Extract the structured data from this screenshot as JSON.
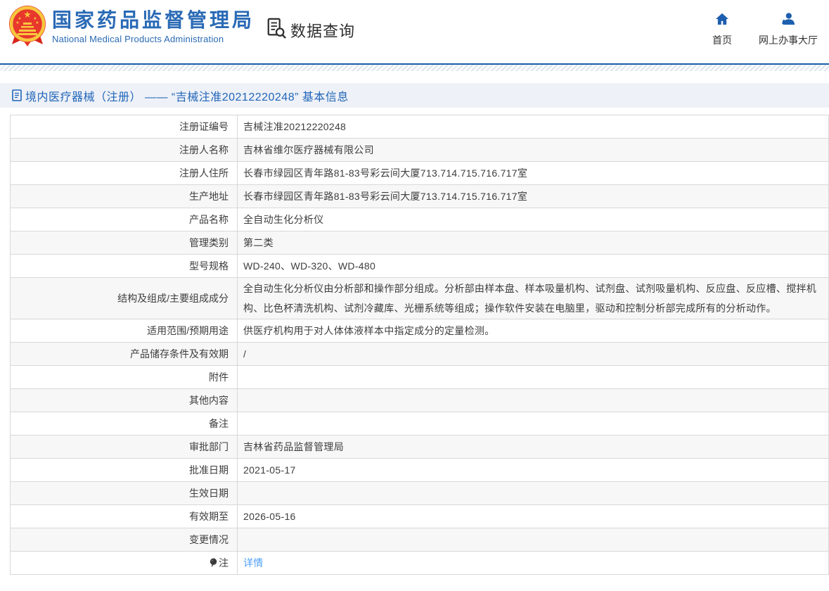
{
  "brand": {
    "name_zh": "国家药品监督管理局",
    "name_en": "National Medical Products Administration"
  },
  "top_nav": {
    "data_query_label": "数据查询",
    "home_label": "首页",
    "service_hall_label": "网上办事大厅"
  },
  "page_title": {
    "text": "境内医疗器械（注册） —— “吉械注准20212220248” 基本信息"
  },
  "colors": {
    "brand_blue": "#2a6ab5",
    "separator_blue": "#1a5fa8",
    "title_bar_bg": "#eef1f7",
    "title_text_blue": "#2065b8",
    "table_border": "#d8d8d8",
    "row_alt_bg": "#f7f7f7",
    "link_blue": "#4d9df5",
    "emblem_red": "#e8372c",
    "emblem_gold": "#f7c73e"
  },
  "table": {
    "rows": [
      {
        "label": "注册证编号",
        "value": "吉械注准20212220248"
      },
      {
        "label": "注册人名称",
        "value": "吉林省维尔医疗器械有限公司"
      },
      {
        "label": "注册人住所",
        "value": "长春市绿园区青年路81-83号彩云间大厦713.714.715.716.717室"
      },
      {
        "label": "生产地址",
        "value": "长春市绿园区青年路81-83号彩云间大厦713.714.715.716.717室"
      },
      {
        "label": "产品名称",
        "value": "全自动生化分析仪"
      },
      {
        "label": "管理类别",
        "value": "第二类"
      },
      {
        "label": "型号规格",
        "value": "WD-240、WD-320、WD-480"
      },
      {
        "label": "结构及组成/主要组成成分",
        "value": "全自动生化分析仪由分析部和操作部分组成。分析部由样本盘、样本吸量机构、试剂盘、试剂吸量机构、反应盘、反应槽、搅拌机构、比色杯清洗机构、试剂冷藏库、光栅系统等组成；操作软件安装在电脑里，驱动和控制分析部完成所有的分析动作。",
        "tall": true
      },
      {
        "label": "适用范围/预期用途",
        "value": "供医疗机构用于对人体体液样本中指定成分的定量检测。"
      },
      {
        "label": "产品储存条件及有效期",
        "value": "/"
      },
      {
        "label": "附件",
        "value": ""
      },
      {
        "label": "其他内容",
        "value": ""
      },
      {
        "label": "备注",
        "value": ""
      },
      {
        "label": "审批部门",
        "value": "吉林省药品监督管理局"
      },
      {
        "label": "批准日期",
        "value": "2021-05-17"
      },
      {
        "label": "生效日期",
        "value": ""
      },
      {
        "label": "有效期至",
        "value": "2026-05-16"
      },
      {
        "label": "变更情况",
        "value": ""
      },
      {
        "label": "注",
        "value": "详情",
        "icon": "note-bulb",
        "link": true
      }
    ]
  }
}
